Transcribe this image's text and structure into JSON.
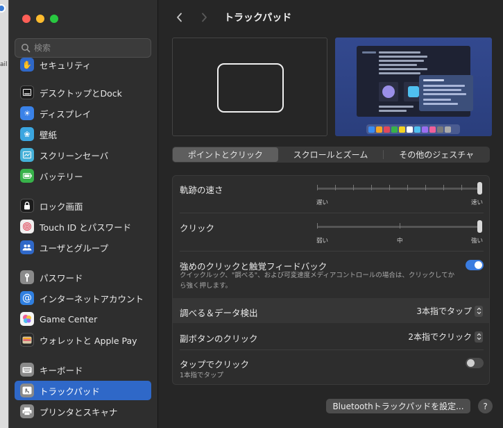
{
  "window": {
    "title": "トラックパッド"
  },
  "backdrop": {
    "partial_text": "ail"
  },
  "search": {
    "placeholder": "検索",
    "value": ""
  },
  "sidebar": {
    "items": [
      {
        "label": "セキュリティ",
        "icon": "lock-shield-icon",
        "color": "#2f68c8"
      },
      {
        "label": "デスクトップとDock",
        "icon": "desktop-dock-icon",
        "color": "#1c1c1c"
      },
      {
        "label": "ディスプレイ",
        "icon": "sun-icon",
        "color": "#3a82e8"
      },
      {
        "label": "壁紙",
        "icon": "wallpaper-icon",
        "color": "#3ba6e0"
      },
      {
        "label": "スクリーンセーバ",
        "icon": "screensaver-icon",
        "color": "#45b0d8"
      },
      {
        "label": "バッテリー",
        "icon": "battery-icon",
        "color": "#38b24a"
      },
      {
        "label": "ロック画面",
        "icon": "lock-icon",
        "color": "#1c1c1c"
      },
      {
        "label": "Touch ID とパスワード",
        "icon": "fingerprint-icon",
        "color": "#f0eeee"
      },
      {
        "label": "ユーザとグループ",
        "icon": "users-icon",
        "color": "#2f68c8"
      },
      {
        "label": "パスワード",
        "icon": "key-icon",
        "color": "#8a8a8a"
      },
      {
        "label": "インターネットアカウント",
        "icon": "at-icon",
        "color": "#2f7fe0"
      },
      {
        "label": "Game Center",
        "icon": "game-center-icon",
        "color": "#f5f5f5"
      },
      {
        "label": "ウォレットと Apple Pay",
        "icon": "wallet-icon",
        "color": "#2a2a2a"
      },
      {
        "label": "キーボード",
        "icon": "keyboard-icon",
        "color": "#8a8a8a"
      },
      {
        "label": "トラックパッド",
        "icon": "trackpad-icon",
        "color": "#8a8a8a"
      },
      {
        "label": "プリンタとスキャナ",
        "icon": "printer-icon",
        "color": "#8a8a8a"
      }
    ],
    "active_index": 14
  },
  "tabs": {
    "items": [
      "ポイントとクリック",
      "スクロールとズーム",
      "その他のジェスチャ"
    ],
    "active_index": 0
  },
  "settings": {
    "tracking_speed": {
      "label": "軌跡の速さ",
      "min_label": "遅い",
      "max_label": "速い",
      "value": 1.0
    },
    "click": {
      "label": "クリック",
      "min_label": "弱い",
      "mid_label": "中",
      "max_label": "強い",
      "value": 1.0
    },
    "force_click": {
      "label": "強めのクリックと触覚フィードバック",
      "description": "クイックルック、\"調べる\"、および可変速度メディアコントロールの場合は、クリックしてから強く押します。",
      "enabled": true
    },
    "lookup": {
      "label": "調べる＆データ検出",
      "value": "3本指でタップ"
    },
    "secondary_click": {
      "label": "副ボタンのクリック",
      "value": "2本指でクリック"
    },
    "tap_to_click": {
      "label": "タップでクリック",
      "sub_label": "1本指でタップ",
      "enabled": false
    }
  },
  "footer": {
    "bluetooth_button": "Bluetoothトラックパッドを設定...",
    "help_button": "?"
  },
  "colors": {
    "accent": "#3a7ce0",
    "sidebar_selected": "#2f68c8"
  }
}
